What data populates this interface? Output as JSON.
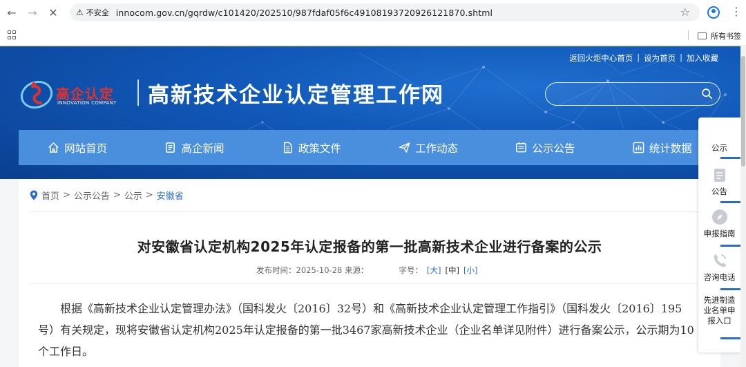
{
  "browser": {
    "security_label": "不安全",
    "url": "innocom.gov.cn/gqrdw/c101420/202510/987fdaf05f6c49108193720926121870.shtml",
    "bookmarks_all": "所有书签"
  },
  "site": {
    "logo_text": "高企认定",
    "logo_sub": "INNOVATION COMPANY",
    "title": "高新技术企业认定管理工作网",
    "top_links": [
      "返回火炬中心首页",
      "设为首页",
      "加入收藏"
    ],
    "top_link_sep": "|",
    "search_placeholder": ""
  },
  "nav": [
    {
      "label": "网站首页",
      "icon": "home-icon"
    },
    {
      "label": "高企新闻",
      "icon": "news-icon"
    },
    {
      "label": "政策文件",
      "icon": "document-icon"
    },
    {
      "label": "工作动态",
      "icon": "paper-plane-icon"
    },
    {
      "label": "公示公告",
      "icon": "notice-icon"
    },
    {
      "label": "统计数据",
      "icon": "chart-icon"
    }
  ],
  "breadcrumb": {
    "items": [
      "首页",
      "公示公告",
      "公示"
    ],
    "current": "安徽省",
    "sep": ">"
  },
  "article": {
    "title": "对安徽省认定机构2025年认定报备的第一批高新技术企业进行备案的公示",
    "meta_date_label": "发布时间：2025-10-28 来源：",
    "meta_size_label": "字号：",
    "size_large": "[大]",
    "size_medium": "[中]",
    "size_small": "[小]",
    "body": "根据《高新技术企业认定管理办法》（国科发火〔2016〕32号）和《高新技术企业认定管理工作指引》（国科发火〔2016〕195号）有关规定，现将安徽省认定机构2025年认定报备的第一批3467家高新技术企业（企业名单详见附件）进行备案公示，公示期为10个工作日。"
  },
  "side_tools": [
    {
      "label": "公示",
      "icon": "notice-icon"
    },
    {
      "label": "公告",
      "icon": "announcement-icon"
    },
    {
      "label": "申报指南",
      "icon": "compass-icon"
    },
    {
      "label": "咨询电话",
      "icon": "phone-icon"
    },
    {
      "label": "先进制造业名单申报入口",
      "icon": "factory-icon"
    }
  ],
  "colors": {
    "banner": "#1158b8",
    "nav": "#4a8fde",
    "link": "#2b6cc4",
    "logo_red": "#e0322b"
  }
}
